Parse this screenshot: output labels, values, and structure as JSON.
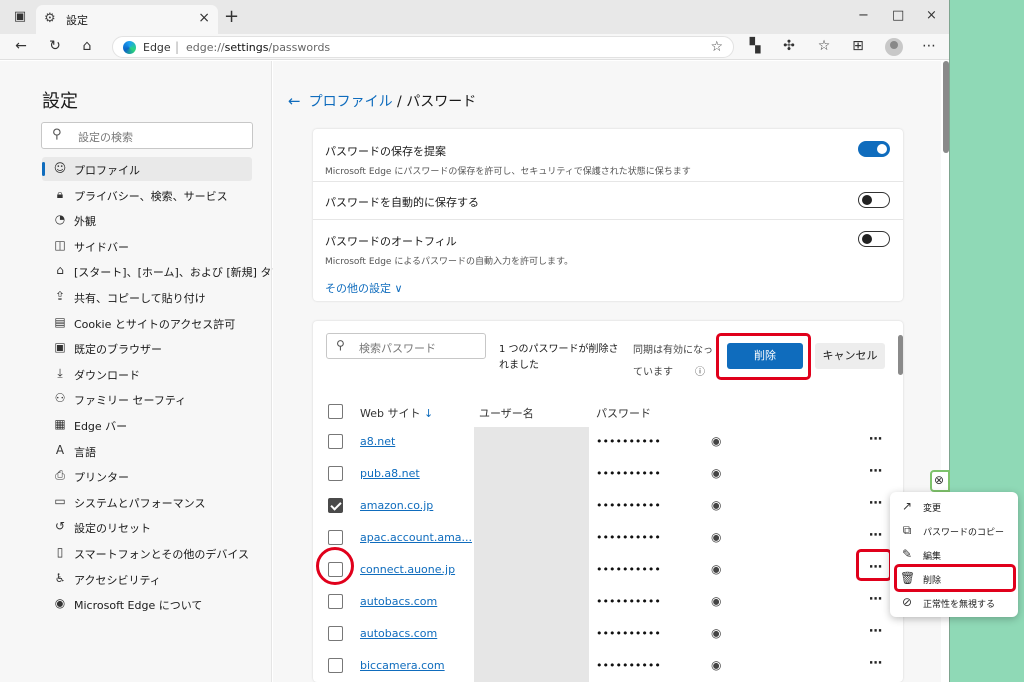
{
  "tab": {
    "title": "設定",
    "close": "×",
    "new": "+"
  },
  "window_controls": {
    "minimize": "−",
    "maximize": "□",
    "close": "×"
  },
  "address": {
    "site": "Edge",
    "separator": "|",
    "url_prefix": "edge://",
    "url_bold": "settings",
    "url_rest": "/passwords"
  },
  "sidebar": {
    "title": "設定",
    "search_placeholder": "設定の検索",
    "items": [
      {
        "label": "プロファイル",
        "icon": "profile-icon",
        "glyph": "☺",
        "active": true
      },
      {
        "label": "プライバシー、検索、サービス",
        "icon": "lock-icon",
        "glyph": "🔒︎"
      },
      {
        "label": "外観",
        "icon": "appearance-icon",
        "glyph": "◔"
      },
      {
        "label": "サイドバー",
        "icon": "sidebar-icon",
        "glyph": "◫"
      },
      {
        "label": "[スタート]、[ホーム]、および [新規] タブ",
        "icon": "home-icon",
        "glyph": "⌂"
      },
      {
        "label": "共有、コピーして貼り付け",
        "icon": "share-icon",
        "glyph": "⇪"
      },
      {
        "label": "Cookie とサイトのアクセス許可",
        "icon": "cookie-icon",
        "glyph": "▤"
      },
      {
        "label": "既定のブラウザー",
        "icon": "browser-icon",
        "glyph": "▣"
      },
      {
        "label": "ダウンロード",
        "icon": "download-icon",
        "glyph": "⤓"
      },
      {
        "label": "ファミリー セーフティ",
        "icon": "family-icon",
        "glyph": "⚇"
      },
      {
        "label": "Edge バー",
        "icon": "edge-bar-icon",
        "glyph": "▦"
      },
      {
        "label": "言語",
        "icon": "language-icon",
        "glyph": "A"
      },
      {
        "label": "プリンター",
        "icon": "printer-icon",
        "glyph": "⎙"
      },
      {
        "label": "システムとパフォーマンス",
        "icon": "system-icon",
        "glyph": "▭"
      },
      {
        "label": "設定のリセット",
        "icon": "reset-icon",
        "glyph": "↺"
      },
      {
        "label": "スマートフォンとその他のデバイス",
        "icon": "phone-icon",
        "glyph": "▯"
      },
      {
        "label": "アクセシビリティ",
        "icon": "accessibility-icon",
        "glyph": "♿︎"
      },
      {
        "label": "Microsoft Edge について",
        "icon": "edge-logo-icon",
        "glyph": "◉"
      }
    ]
  },
  "breadcrumb": {
    "back": "←",
    "parent": "プロファイル",
    "separator": " / ",
    "current": "パスワード"
  },
  "settings": {
    "offer_save": {
      "title": "パスワードの保存を提案",
      "desc": "Microsoft Edge にパスワードの保存を許可し、セキュリティで保護された状態に保ちます",
      "on": true
    },
    "auto_save": {
      "title": "パスワードを自動的に保存する",
      "on": false
    },
    "autofill": {
      "title": "パスワードのオートフィル",
      "desc": "Microsoft Edge によるパスワードの自動入力を許可します。",
      "on": false
    },
    "more_settings": "その他の設定 ∨"
  },
  "passwords": {
    "search_placeholder": "検索パスワード",
    "deleted_msg_line1": "1 つのパスワードが削除さ",
    "deleted_msg_line2": "れました",
    "sync_msg_line1": "同期は有効になっ",
    "sync_msg_line2": "ています",
    "info": "ⓘ",
    "delete_button": "削除",
    "cancel_button": "キャンセル",
    "headers": {
      "site": "Web サイト",
      "sort": "↓",
      "user": "ユーザー名",
      "password": "パスワード"
    },
    "rows": [
      {
        "site": "a8.net",
        "password": "••••••••••",
        "checked": false
      },
      {
        "site": "pub.a8.net",
        "password": "••••••••••",
        "checked": false
      },
      {
        "site": "amazon.co.jp",
        "password": "••••••••••",
        "checked": true
      },
      {
        "site": "apac.account.ama...",
        "password": "••••••••••",
        "checked": false
      },
      {
        "site": "connect.auone.jp",
        "password": "••••••••••",
        "checked": false
      },
      {
        "site": "autobacs.com",
        "password": "••••••••••",
        "checked": false
      },
      {
        "site": "autobacs.com",
        "password": "••••••••••",
        "checked": false
      },
      {
        "site": "biccamera.com",
        "password": "••••••••••",
        "checked": false
      }
    ]
  },
  "context_menu": [
    {
      "label": "変更",
      "icon": "edit-external-icon",
      "glyph": "↗"
    },
    {
      "label": "パスワードのコピー",
      "icon": "copy-icon",
      "glyph": "⧉"
    },
    {
      "label": "編集",
      "icon": "pencil-icon",
      "glyph": "✎"
    },
    {
      "label": "削除",
      "icon": "trash-icon",
      "glyph": "🗑︎"
    },
    {
      "label": "正常性を無視する",
      "icon": "ignore-icon",
      "glyph": "⊘"
    }
  ],
  "colors": {
    "accent": "#0f6cbd",
    "highlight": "#e0001b",
    "background": "#8fd9b6"
  }
}
